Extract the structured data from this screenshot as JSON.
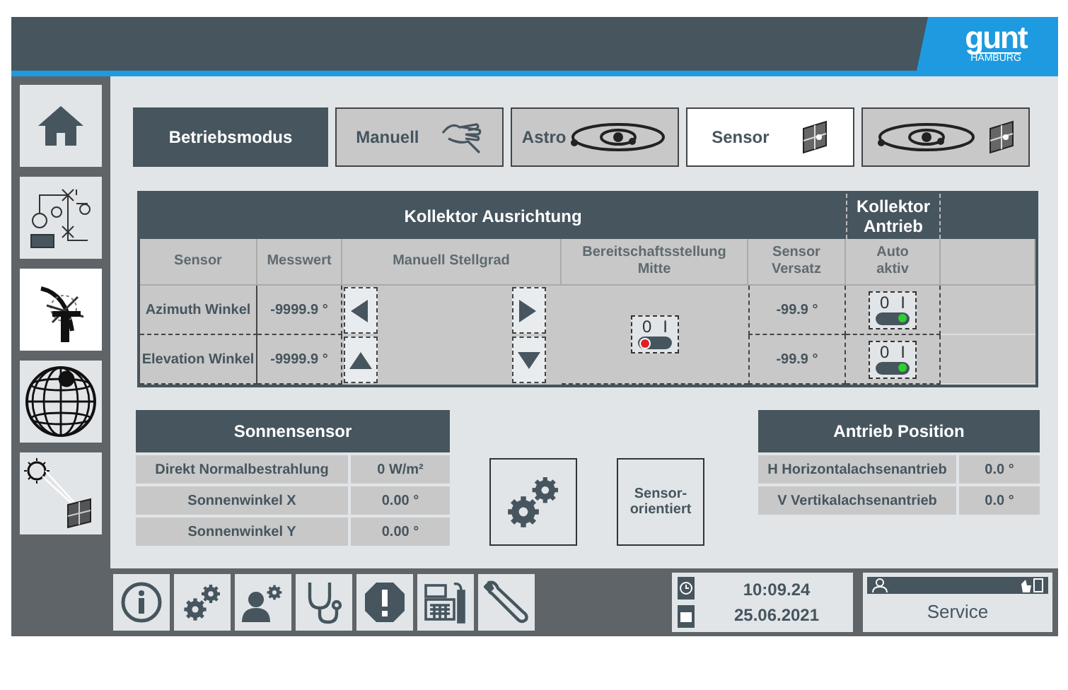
{
  "header": {
    "logo": "gunt",
    "logo_sub": "HAMBURG"
  },
  "sidebar": {
    "items": [
      {
        "kind": "home",
        "selected": false
      },
      {
        "kind": "process",
        "selected": false
      },
      {
        "kind": "collector",
        "selected": true
      },
      {
        "kind": "globe",
        "selected": false
      },
      {
        "kind": "sun-sensor",
        "selected": false
      }
    ]
  },
  "mode_bar": {
    "label": "Betriebsmodus",
    "tabs": [
      {
        "kind": "manual",
        "label": "Manuell",
        "selected": false
      },
      {
        "kind": "astro",
        "label": "Astro",
        "selected": false
      },
      {
        "kind": "sensor",
        "label": "Sensor",
        "selected": true
      },
      {
        "kind": "combined",
        "selected": false
      }
    ]
  },
  "table": {
    "title": "Kollektor Ausrichtung",
    "drive_title": "Kollektor Antrieb",
    "columns": [
      "Sensor",
      "Messwert",
      "Manuell Stellgrad",
      "Bereitschaftsstellung Mitte",
      "Sensor Versatz",
      "Auto aktiv"
    ],
    "standby": {
      "on": false,
      "off_label": "0",
      "on_label": "I"
    },
    "rows": [
      {
        "sensor": "Azimuth Winkel",
        "value": "-9999.9 °",
        "kind": "horizontal",
        "offset": "-99.9 °",
        "auto": {
          "on": true,
          "off_label": "0",
          "on_label": "I"
        }
      },
      {
        "sensor": "Elevation Winkel",
        "value": "-9999.9 °",
        "kind": "vertical",
        "offset": "-99.9 °",
        "auto": {
          "on": true,
          "off_label": "0",
          "on_label": "I"
        }
      }
    ]
  },
  "sun_sensor": {
    "title": "Sonnensensor",
    "rows": [
      {
        "label": "Direkt Normalbestrahlung",
        "value": "0 W/m²"
      },
      {
        "label": "Sonnenwinkel X",
        "value": "0.00 °"
      },
      {
        "label": "Sonnenwinkel Y",
        "value": "0.00 °"
      }
    ]
  },
  "actions": [
    {
      "kind": "settings"
    },
    {
      "kind": "text",
      "label": "Sensor-orientiert"
    }
  ],
  "drive_position": {
    "title": "Antrieb Position",
    "rows": [
      {
        "label": "H Horizontalachsenantrieb",
        "value": "0.0 °"
      },
      {
        "label": "V Vertikalachsenantrieb",
        "value": "0.0 °"
      }
    ]
  },
  "toolbar": {
    "buttons": [
      {
        "kind": "info"
      },
      {
        "kind": "settings"
      },
      {
        "kind": "user-settings"
      },
      {
        "kind": "stethoscope"
      },
      {
        "kind": "alert"
      },
      {
        "kind": "device"
      },
      {
        "kind": "wrench"
      }
    ]
  },
  "clock": {
    "time": "10:09.24",
    "date": "25.06.2021"
  },
  "user": {
    "name": "Service"
  }
}
